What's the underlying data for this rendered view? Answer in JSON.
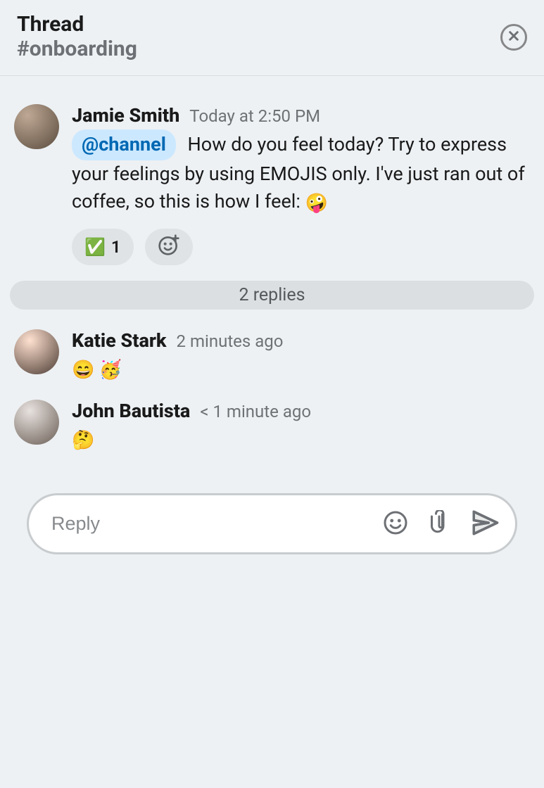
{
  "header": {
    "title": "Thread",
    "channel": "#onboarding"
  },
  "root_message": {
    "author": "Jamie Smith",
    "timestamp": "Today at 2:50 PM",
    "mention": "@channel",
    "body_after_mention": "How do you feel today? Try to express your feelings by using EMOJIS only. I've just ran out of coffee, so this is how I feel:",
    "trailing_emoji": "🤪",
    "reactions": [
      {
        "emoji": "✅",
        "count": "1"
      }
    ]
  },
  "replies_separator": "2 replies",
  "replies": [
    {
      "author": "Katie Stark",
      "timestamp": "2 minutes ago",
      "body": "😄 🥳"
    },
    {
      "author": "John Bautista",
      "timestamp": "< 1 minute ago",
      "body": "🤔"
    }
  ],
  "composer": {
    "placeholder": "Reply"
  },
  "icons": {
    "close": "close-icon",
    "add_reaction": "add-reaction-icon",
    "emoji": "emoji-icon",
    "attach": "paperclip-icon",
    "send": "send-icon"
  }
}
